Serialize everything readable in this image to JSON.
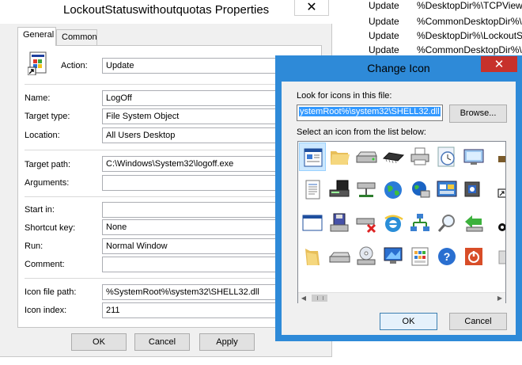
{
  "background_list": {
    "rows": [
      {
        "action": "Update",
        "target": "%DesktopDir%\\TCPViewS"
      },
      {
        "action": "Update",
        "target": "%CommonDesktopDir%\\T"
      },
      {
        "action": "Update",
        "target": "%DesktopDir%\\LockoutSt"
      },
      {
        "action": "Update",
        "target": "%CommonDesktopDir%\\"
      }
    ]
  },
  "properties": {
    "title": "LockoutStatuswithoutquotas Properties",
    "close_glyph": "✕",
    "tabs": {
      "general": "General",
      "common": "Common"
    },
    "action_label": "Action:",
    "action_value": "Update",
    "fields": {
      "name": {
        "label": "Name:",
        "value": "LogOff"
      },
      "target_type": {
        "label": "Target type:",
        "value": "File System Object"
      },
      "location": {
        "label": "Location:",
        "value": "All Users Desktop"
      },
      "target_path": {
        "label": "Target path:",
        "value": "C:\\Windows\\System32\\logoff.exe"
      },
      "arguments": {
        "label": "Arguments:",
        "value": ""
      },
      "start_in": {
        "label": "Start in:",
        "value": ""
      },
      "shortcut_key": {
        "label": "Shortcut key:",
        "value": "None"
      },
      "run": {
        "label": "Run:",
        "value": "Normal Window"
      },
      "comment": {
        "label": "Comment:",
        "value": ""
      },
      "icon_file_path": {
        "label": "Icon file path:",
        "value": "%SystemRoot%\\system32\\SHELL32.dll"
      },
      "icon_index": {
        "label": "Icon index:",
        "value": "211"
      }
    },
    "buttons": {
      "ok": "OK",
      "cancel": "Cancel",
      "apply": "Apply"
    }
  },
  "change_icon": {
    "title": "Change Icon",
    "close_glyph": "✕",
    "look_label": "Look for icons in this file:",
    "file_value": "ystemRoot%\\system32\\SHELL32.dll",
    "browse_label": "Browse...",
    "select_label": "Select an icon from the list below:",
    "icons": [
      [
        "document-window-icon",
        "folder-icon",
        "drive-icon",
        "memory-chip-icon",
        "printer-icon",
        "clock-icon",
        "display-icon",
        "overflow-icon"
      ],
      [
        "text-document-icon",
        "drive-keyboard-icon",
        "network-drive-icon",
        "globe-icon",
        "network-globe-icon",
        "control-panel-icon",
        "app-window-icon",
        "shortcut-arrow-icon"
      ],
      [
        "window-icon",
        "floppy-drive-icon",
        "disconnected-drive-icon",
        "internet-explorer-icon",
        "network-icon",
        "magnifier-icon",
        "green-arrow-icon",
        "black-circle-icon"
      ],
      [
        "folder-open-icon",
        "hard-drive-icon",
        "dvd-drive-icon",
        "monitor-icon",
        "calculator-icon",
        "help-icon",
        "power-icon",
        "overflow-icon"
      ]
    ],
    "buttons": {
      "ok": "OK",
      "cancel": "Cancel"
    }
  }
}
